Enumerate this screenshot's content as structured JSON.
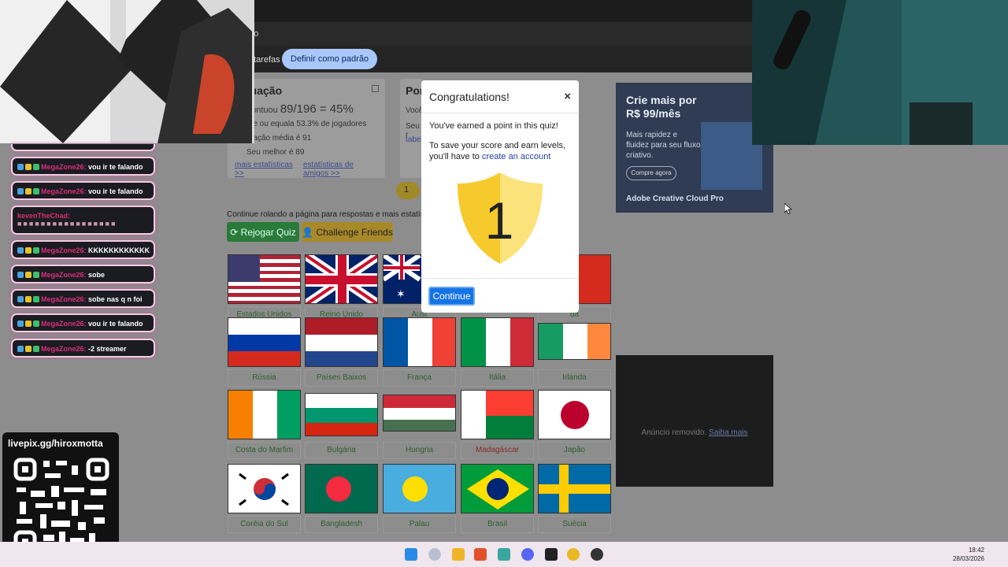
{
  "browser": {
    "address_fragment": "ado",
    "bookmark_fragment": "tarefas",
    "set_default_label": "Definir como padrão"
  },
  "stats": {
    "heading": "tuação",
    "score_prefix": "pontuou",
    "score": "89/196 = 45%",
    "line1": "ate ou equala 53.3% de jogadores",
    "line2": "tuação média é 91",
    "line3": "Seu melhor é 89",
    "link_more": "mais estatísticas >>",
    "link_friends": "estatísticas de amigos >>"
  },
  "stats2": {
    "heading": "Pon",
    "line1": "Você",
    "line2": "Seu r",
    "link": "tabel"
  },
  "page": {
    "badge": "1",
    "continue_note": "Continue rolando a página para respostas e mais estatística",
    "retry_label": "Rejogar Quiz",
    "challenge_label": "Challenge Friends"
  },
  "flags": [
    {
      "caption": "Estados Unidos"
    },
    {
      "caption": "Reino Unido"
    },
    {
      "caption": "Aust"
    },
    {
      "caption": ""
    },
    {
      "caption": "dá"
    },
    {
      "caption": "Rússia"
    },
    {
      "caption": "Países Baixos"
    },
    {
      "caption": "França"
    },
    {
      "caption": "Itália"
    },
    {
      "caption": "Irlanda"
    },
    {
      "caption": "Costa do Marfim"
    },
    {
      "caption": "Bulgária"
    },
    {
      "caption": "Hungria"
    },
    {
      "caption": "Madagáscar"
    },
    {
      "caption": "Japão"
    },
    {
      "caption": "Coréia do Sul"
    },
    {
      "caption": "Bangladesh"
    },
    {
      "caption": "Palau"
    },
    {
      "caption": "Brasil"
    },
    {
      "caption": "Suécia"
    }
  ],
  "ad": {
    "headline1": "Crie mais por",
    "headline2": "R$ 99/mês",
    "body": "Mais rapidez e fluidez para seu fluxo criativo.",
    "cta": "Compre agora",
    "brand": "Adobe Creative Cloud Pro"
  },
  "ad_removed": {
    "text": "Anúncio removido.",
    "link": "Saiba mais"
  },
  "modal": {
    "title": "Congratulations!",
    "close": "×",
    "line1": "You've earned a point in this quiz!",
    "line2_prefix": "To save your score and earn levels, you'll have to",
    "line2_link": "create an account",
    "shield_number": "1",
    "continue_label": "Continue"
  },
  "chat": [
    {
      "user": "MegaZone26:",
      "text": "vou ir te falando"
    },
    {
      "user": "MegaZone26:",
      "text": "vou ir te falando"
    },
    {
      "user": "kevenTheChad:",
      "text": ""
    },
    {
      "user": "MegaZone26:",
      "text": "KKKKKKKKKKKK"
    },
    {
      "user": "MegaZone26:",
      "text": "sobe"
    },
    {
      "user": "MegaZone26:",
      "text": "sobe nas q n foi"
    },
    {
      "user": "MegaZone26:",
      "text": "vou ir te falando"
    },
    {
      "user": "MegaZone26:",
      "text": "-2 streamer"
    }
  ],
  "livepix": {
    "label": "livepix.gg/hiroxmotta"
  },
  "taskbar": {
    "time": "18:42",
    "date": "28/03/2026"
  }
}
